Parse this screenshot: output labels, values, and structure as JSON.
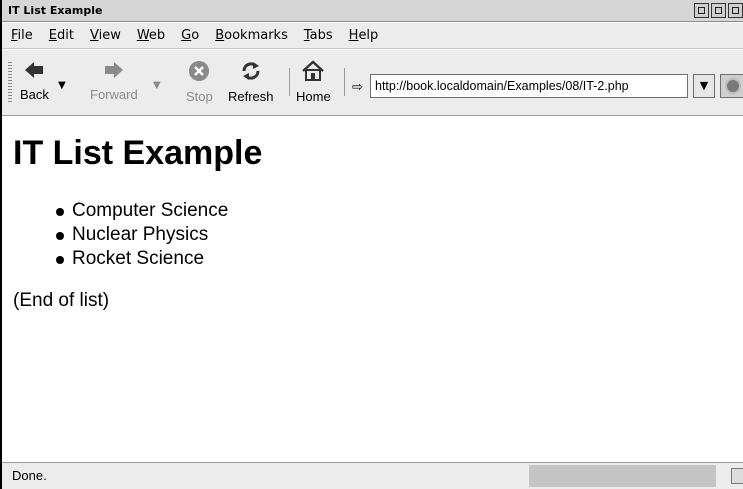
{
  "window": {
    "title": "IT List Example"
  },
  "menu": [
    "File",
    "Edit",
    "View",
    "Web",
    "Go",
    "Bookmarks",
    "Tabs",
    "Help"
  ],
  "menu_mnemonics": [
    "F",
    "E",
    "V",
    "W",
    "G",
    "B",
    "T",
    "H"
  ],
  "toolbar": {
    "back": "Back",
    "forward": "Forward",
    "stop": "Stop",
    "refresh": "Refresh",
    "home": "Home"
  },
  "address": {
    "url": "http://book.localdomain/Examples/08/IT-2.php"
  },
  "page": {
    "heading": "IT List Example",
    "items": [
      "Computer Science",
      "Nuclear Physics",
      "Rocket Science"
    ],
    "footer": "(End of list)"
  },
  "status": {
    "text": "Done."
  }
}
